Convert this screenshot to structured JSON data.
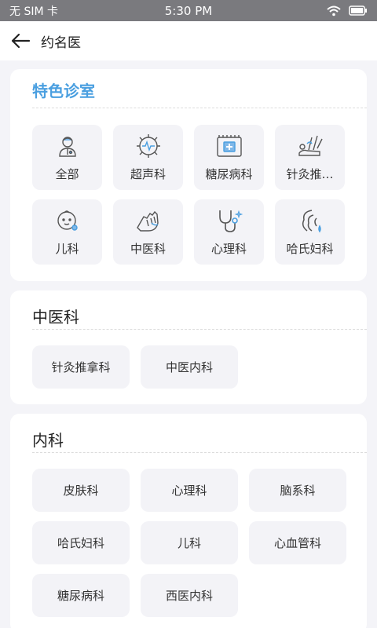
{
  "status_bar": {
    "carrier": "无 SIM 卡",
    "time": "5:30 PM",
    "wifi_icon": "wifi-icon",
    "battery_icon": "battery-icon"
  },
  "header": {
    "title": "约名医",
    "back_icon": "back-arrow-icon"
  },
  "featured": {
    "title": "特色诊室",
    "accent_color": "#4a9fe0",
    "items": [
      {
        "label": "全部",
        "icon": "doctor-icon"
      },
      {
        "label": "超声科",
        "icon": "ultrasound-icon"
      },
      {
        "label": "糖尿病科",
        "icon": "medical-case-icon"
      },
      {
        "label": "针灸推…",
        "icon": "acupuncture-icon"
      },
      {
        "label": "儿科",
        "icon": "baby-icon"
      },
      {
        "label": "中医科",
        "icon": "pulse-hand-icon"
      },
      {
        "label": "心理科",
        "icon": "stethoscope-icon"
      },
      {
        "label": "哈氏妇科",
        "icon": "woman-icon"
      }
    ]
  },
  "tcm": {
    "title": "中医科",
    "items": [
      "针灸推拿科",
      "中医内科"
    ]
  },
  "internal": {
    "title": "内科",
    "items": [
      "皮肤科",
      "心理科",
      "脑系科",
      "哈氏妇科",
      "儿科",
      "心血管科",
      "糖尿病科",
      "西医内科"
    ]
  }
}
